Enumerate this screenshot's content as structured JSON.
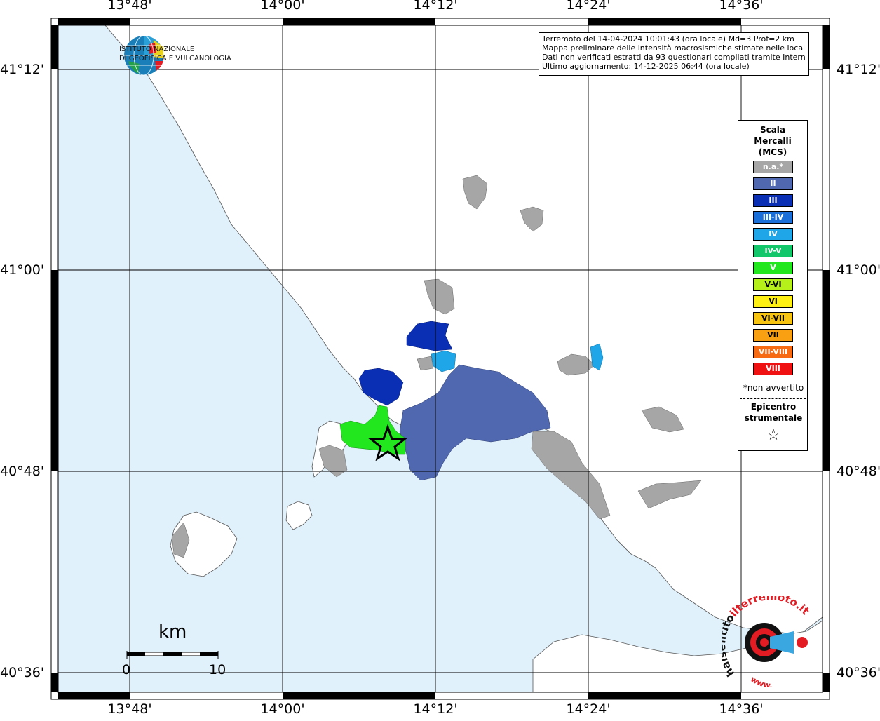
{
  "map": {
    "longitude_ticks": [
      "13°48'",
      "14°00'",
      "14°12'",
      "14°24'",
      "14°36'"
    ],
    "latitude_ticks": [
      "41°12'",
      "41°00'",
      "40°48'",
      "40°36'"
    ]
  },
  "logo": {
    "line1": "ISTITUTO NAZIONALE",
    "line2": "DI GEOFISICA E VULCANOLOGIA"
  },
  "info": {
    "line1": "Terremoto del 14-04-2024 10:01:43 (ora locale) Md=3 Prof=2 km",
    "line2": "Mappa preliminare delle intensità macrosismiche stimate nelle località",
    "line3": "Dati non verificati estratti da 93 questionari compilati tramite Internet.",
    "line4": "Ultimo aggiornamento: 14-12-2025 06:44 (ora locale)"
  },
  "legend": {
    "title1": "Scala",
    "title2": "Mercalli",
    "title3": "(MCS)",
    "items": [
      {
        "label": "n.a.*",
        "color": "#a6a6a6"
      },
      {
        "label": "II",
        "color": "#5068b0"
      },
      {
        "label": "III",
        "color": "#0a2fb4"
      },
      {
        "label": "III-IV",
        "color": "#1a6fd8"
      },
      {
        "label": "IV",
        "color": "#1ea6e8"
      },
      {
        "label": "IV-V",
        "color": "#12c66a"
      },
      {
        "label": "V",
        "color": "#22e61e"
      },
      {
        "label": "V-VI",
        "color": "#b6f01a"
      },
      {
        "label": "VI",
        "color": "#fff014"
      },
      {
        "label": "VI-VII",
        "color": "#f8c412"
      },
      {
        "label": "VII",
        "color": "#f8a012"
      },
      {
        "label": "VII-VIII",
        "color": "#f86a12"
      },
      {
        "label": "VIII",
        "color": "#f01212"
      }
    ],
    "note": "*non avvertito",
    "epicenter1": "Epicentro",
    "epicenter2": "strumentale",
    "star": "☆"
  },
  "scale_bar": {
    "unit": "km",
    "start": "0",
    "end": "10"
  },
  "watermark": {
    "text1": "haisentito",
    "text2": "ilterremoto.it",
    "text3": "www.",
    "colors": {
      "red": "#e31b23",
      "blue": "#3aa7e0",
      "black": "#111111"
    }
  },
  "colors": {
    "sea": "#e1f1fb",
    "land": "#ffffff",
    "grid": "#000000"
  }
}
